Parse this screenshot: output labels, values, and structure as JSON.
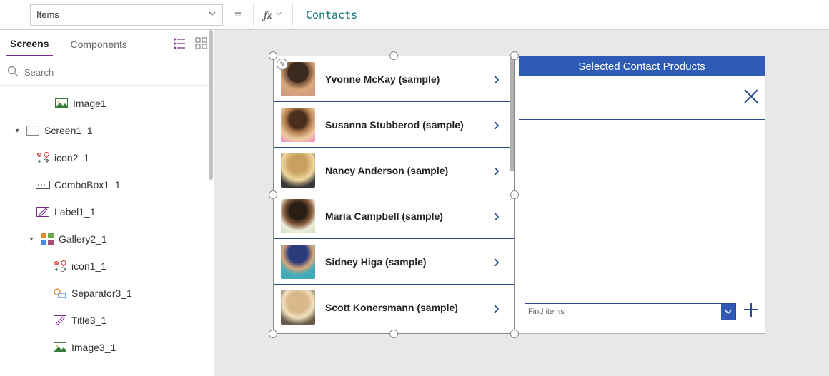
{
  "formula_bar": {
    "property": "Items",
    "formula": "Contacts"
  },
  "left_pane": {
    "tab_screens": "Screens",
    "tab_components": "Components",
    "search_placeholder": "Search"
  },
  "tree": {
    "image1": "Image1",
    "screen1_1": "Screen1_1",
    "icon2_1": "icon2_1",
    "combobox1_1": "ComboBox1_1",
    "label1_1": "Label1_1",
    "gallery2_1": "Gallery2_1",
    "icon1_1": "icon1_1",
    "separator3_1": "Separator3_1",
    "title3_1": "Title3_1",
    "image3_1": "Image3_1"
  },
  "gallery_items": [
    "Yvonne McKay (sample)",
    "Susanna Stubberod (sample)",
    "Nancy Anderson (sample)",
    "Maria Campbell (sample)",
    "Sidney Higa (sample)",
    "Scott Konersmann (sample)"
  ],
  "right_panel": {
    "header": "Selected Contact Products",
    "combo_placeholder": "Find items"
  }
}
